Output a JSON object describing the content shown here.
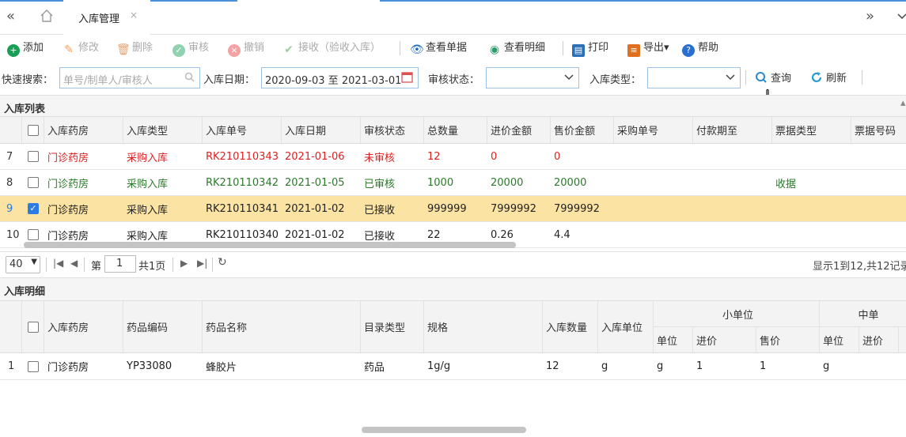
{
  "tabs": {
    "back_icon": "«",
    "home_icon": "home",
    "active_label": "入库管理",
    "close_icon": "×",
    "forward_icon": "»",
    "menu_icon": "chevron-down"
  },
  "toolbar": {
    "add": "添加",
    "edit": "修改",
    "delete": "删除",
    "approve": "审核",
    "revoke": "撤销",
    "receive": "接收（验收入库）",
    "view_doc": "查看单据",
    "view_detail": "查看明细",
    "print": "打印",
    "export": "导出▾",
    "help": "帮助"
  },
  "search": {
    "quick_label": "快速搜索：",
    "quick_placeholder": "单号/制单人/审核人",
    "date_label": "入库日期：",
    "date_value": "2020-09-03 至 2021-03-01",
    "status_label": "审核状态：",
    "status_value": "",
    "type_label": "入库类型：",
    "type_value": "",
    "query": "查询",
    "refresh": "刷新"
  },
  "list": {
    "title": "入库列表",
    "columns": [
      "入库药房",
      "入库类型",
      "入库单号",
      "入库日期",
      "审核状态",
      "总数量",
      "进价金额",
      "售价金额",
      "采购单号",
      "付款期至",
      "票据类型",
      "票据号码"
    ],
    "rows": [
      {
        "no": "7",
        "checked": false,
        "style": "red",
        "cells": [
          "门诊药房",
          "采购入库",
          "RK210110343",
          "2021-01-06",
          "未审核",
          "12",
          "0",
          "0",
          "",
          "",
          "",
          ""
        ]
      },
      {
        "no": "8",
        "checked": false,
        "style": "green",
        "cells": [
          "门诊药房",
          "采购入库",
          "RK210110342",
          "2021-01-05",
          "已审核",
          "1000",
          "20000",
          "20000",
          "",
          "",
          "收据",
          ""
        ]
      },
      {
        "no": "9",
        "checked": true,
        "style": "selected",
        "cells": [
          "门诊药房",
          "采购入库",
          "RK210110341",
          "2021-01-02",
          "已接收",
          "999999",
          "7999992",
          "7999992",
          "",
          "",
          "",
          ""
        ]
      },
      {
        "no": "10",
        "checked": false,
        "style": "normal",
        "cells": [
          "门诊药房",
          "采购入库",
          "RK210110340",
          "2021-01-02",
          "已接收",
          "22",
          "0.26",
          "4.4",
          "",
          "",
          "",
          ""
        ]
      }
    ]
  },
  "pager": {
    "page_size": "40",
    "page_prefix": "第",
    "page_value": "1",
    "page_total": "共1页",
    "summary": "显示1到12,共12记录"
  },
  "detail": {
    "title": "入库明细",
    "columns": [
      "入库药房",
      "药品编码",
      "药品名称",
      "目录类型",
      "规格",
      "入库数量",
      "入库单位"
    ],
    "group_small": "小单位",
    "group_mid": "中单",
    "sub_small": [
      "单位",
      "进价",
      "售价"
    ],
    "sub_mid": [
      "单位",
      "进价"
    ],
    "rows": [
      {
        "no": "1",
        "checked": false,
        "cells": [
          "门诊药房",
          "YP33080",
          "蜂胶片",
          "药品",
          "1g/g",
          "12",
          "g",
          "g",
          "1",
          "1",
          "g",
          ""
        ]
      }
    ]
  }
}
